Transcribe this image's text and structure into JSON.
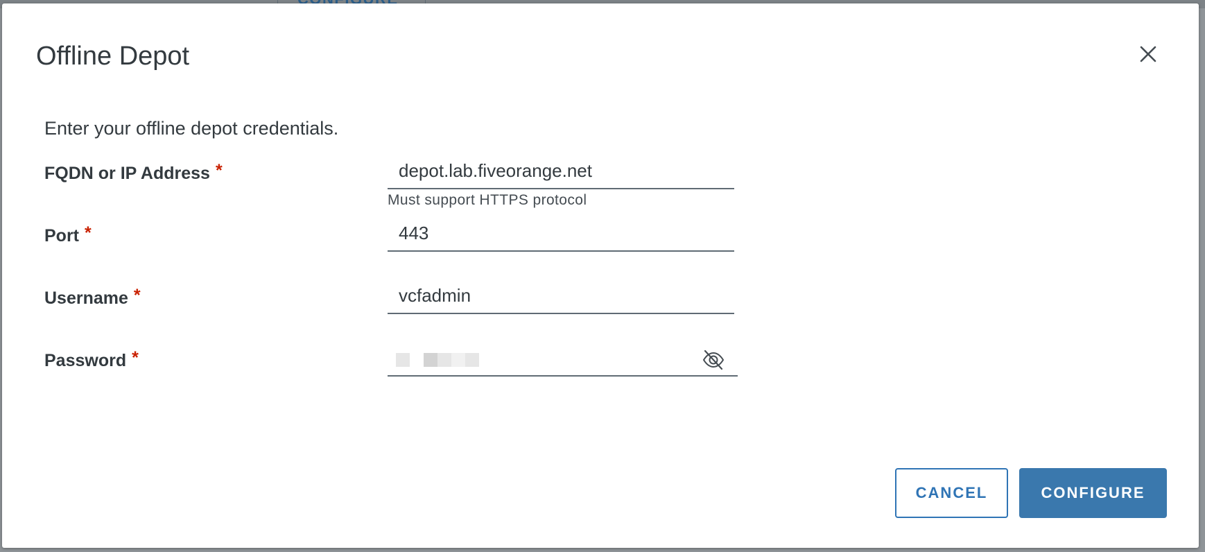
{
  "background": {
    "tab_label": "CONFIGURE"
  },
  "dialog": {
    "title": "Offline Depot",
    "close_label": "×",
    "intro": "Enter your offline depot credentials."
  },
  "form": {
    "required_marker": "*",
    "fqdn": {
      "label": "FQDN or IP Address",
      "value": "depot.lab.fiveorange.net",
      "helper": "Must support HTTPS protocol"
    },
    "port": {
      "label": "Port",
      "value": "443"
    },
    "username": {
      "label": "Username",
      "value": "vcfadmin"
    },
    "password": {
      "label": "Password",
      "toggle_icon": "eye-slash-icon"
    }
  },
  "actions": {
    "cancel_label": "CANCEL",
    "configure_label": "CONFIGURE"
  },
  "colors": {
    "primary": "#3a78ad",
    "primary_outline": "#2f74b5",
    "required": "#c92100",
    "text": "#333a3f",
    "underline": "#5f6b74"
  }
}
